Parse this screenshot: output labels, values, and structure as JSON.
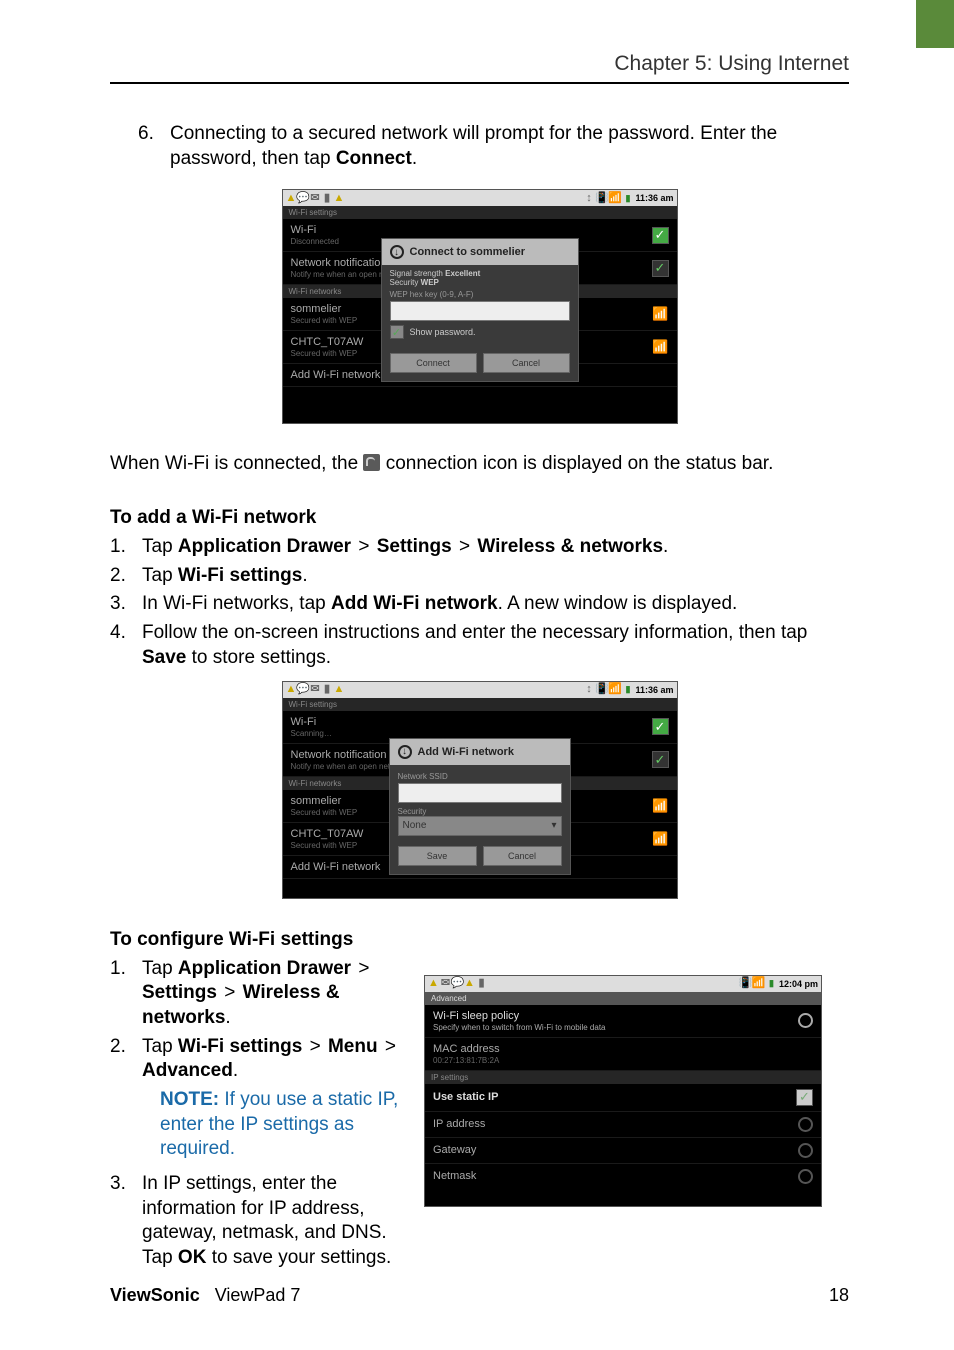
{
  "chapter_title": "Chapter 5: Using Internet",
  "step6": {
    "num": "6.",
    "text1": "Connecting to a secured network will prompt for the password. Enter the password, then tap ",
    "bold": "Connect",
    "text2": "."
  },
  "after_shot1": {
    "t1": "When Wi-Fi is connected, the ",
    "t2": " connection icon is displayed on the status bar."
  },
  "add_heading": "To add a Wi-Fi network",
  "add_steps": [
    {
      "n": "1.",
      "t1": "Tap ",
      "b1": "Application Drawer",
      "t2": " > ",
      "b2": "Settings",
      "t3": " > ",
      "b3": "Wireless & networks",
      "t4": "."
    },
    {
      "n": "2.",
      "t1": "Tap ",
      "b1": "Wi-Fi settings",
      "t4": "."
    },
    {
      "n": "3.",
      "t1": "In Wi-Fi networks, tap ",
      "b1": "Add Wi-Fi network",
      "t4": ". A new window is displayed."
    },
    {
      "n": "4.",
      "t1": "Follow the on-screen instructions and enter the necessary information, then tap ",
      "b1": "Save",
      "t4": " to store settings."
    }
  ],
  "cfg_heading": "To configure Wi-Fi settings",
  "cfg_steps": [
    {
      "n": "1.",
      "t1": "Tap ",
      "b1": "Application Drawer",
      "t2": " > ",
      "b2": "Settings",
      "t3": " > ",
      "b3": "Wireless & networks",
      "t4": "."
    },
    {
      "n": "2.",
      "t1": "Tap ",
      "b1": "Wi-Fi settings",
      "t2": " > ",
      "b2": "Menu",
      "t3": " > ",
      "b3": "Advanced",
      "t4": "."
    }
  ],
  "cfg_note": {
    "label": "NOTE: ",
    "text": "If you use a static IP, enter the IP settings as required."
  },
  "cfg_step3": {
    "n": "3.",
    "t1": "In IP settings, enter the information for IP address, gateway, netmask, and DNS. Tap ",
    "b1": "OK",
    "t2": " to save your settings."
  },
  "footer": {
    "left_bold": "ViewSonic",
    "left_rest": "ViewPad 7",
    "page": "18"
  },
  "shot1": {
    "time": "11:36 am",
    "section": "Wi-Fi settings",
    "rows": {
      "wifi": {
        "lbl": "Wi-Fi",
        "sub": "Disconnected"
      },
      "notif": {
        "lbl": "Network notification",
        "sub": "Notify me when an open network is a…"
      },
      "networks_hdr": "Wi-Fi networks",
      "n1": {
        "lbl": "sommelier",
        "sub": "Secured with WEP"
      },
      "n2": {
        "lbl": "CHTC_T07AW",
        "sub": "Secured with WEP"
      },
      "add": "Add Wi-Fi network"
    },
    "dlg": {
      "title": "Connect to sommelier",
      "sig1": "Signal strength",
      "sig1v": "Excellent",
      "sec1": "Security",
      "sec1v": "WEP",
      "field": "WEP hex key (0-9, A-F)",
      "chk": "Show password.",
      "btn1": "Connect",
      "btn2": "Cancel"
    }
  },
  "shot2": {
    "time": "11:36 am",
    "section": "Wi-Fi settings",
    "rows": {
      "wifi": {
        "lbl": "Wi-Fi",
        "sub": "Scanning…"
      },
      "notif": {
        "lbl": "Network notification",
        "sub": "Notify me when an open network is a…"
      },
      "networks_hdr": "Wi-Fi networks",
      "n1": {
        "lbl": "sommelier",
        "sub": "Secured with WEP"
      },
      "n2": {
        "lbl": "CHTC_T07AW",
        "sub": "Secured with WEP"
      },
      "add": "Add Wi-Fi network"
    },
    "dlg": {
      "title": "Add Wi-Fi network",
      "l1": "Network SSID",
      "l2": "Security",
      "sel": "None",
      "btn1": "Save",
      "btn2": "Cancel"
    }
  },
  "shot3": {
    "time": "12:04 pm",
    "section": "Advanced",
    "rows": {
      "sleep": {
        "lbl": "Wi-Fi sleep policy",
        "sub": "Specify when to switch from Wi-Fi to mobile data"
      },
      "mac": {
        "lbl": "MAC address",
        "sub": "00:27:13:81:7B:2A"
      },
      "ip_hdr": "IP settings",
      "static": "Use static IP",
      "ipaddr": "IP address",
      "gateway": "Gateway",
      "netmask": "Netmask"
    }
  }
}
